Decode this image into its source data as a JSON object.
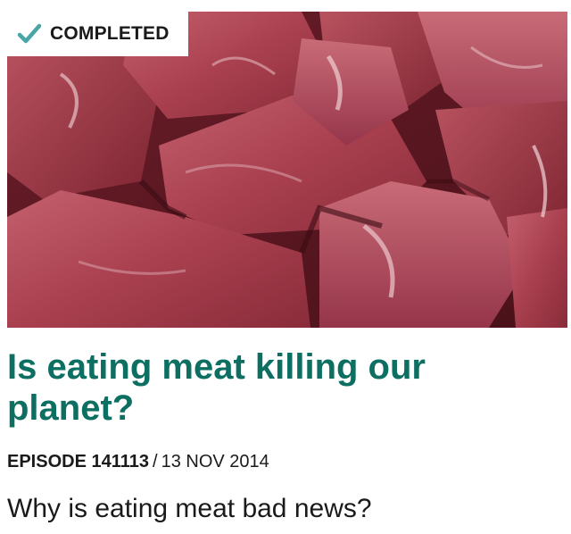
{
  "badge": {
    "status_label": "COMPLETED",
    "icon": "checkmark-icon",
    "icon_color": "#4aa6a6"
  },
  "hero_image": {
    "subject": "raw-meat-chunks"
  },
  "episode": {
    "title": "Is eating meat killing our planet?",
    "number_label": "EPISODE 141113",
    "separator": "/",
    "date": "13 NOV 2014",
    "summary": "Why is eating meat bad news?"
  },
  "colors": {
    "title": "#0d6e62",
    "text": "#1a1a1a",
    "background": "#ffffff"
  }
}
